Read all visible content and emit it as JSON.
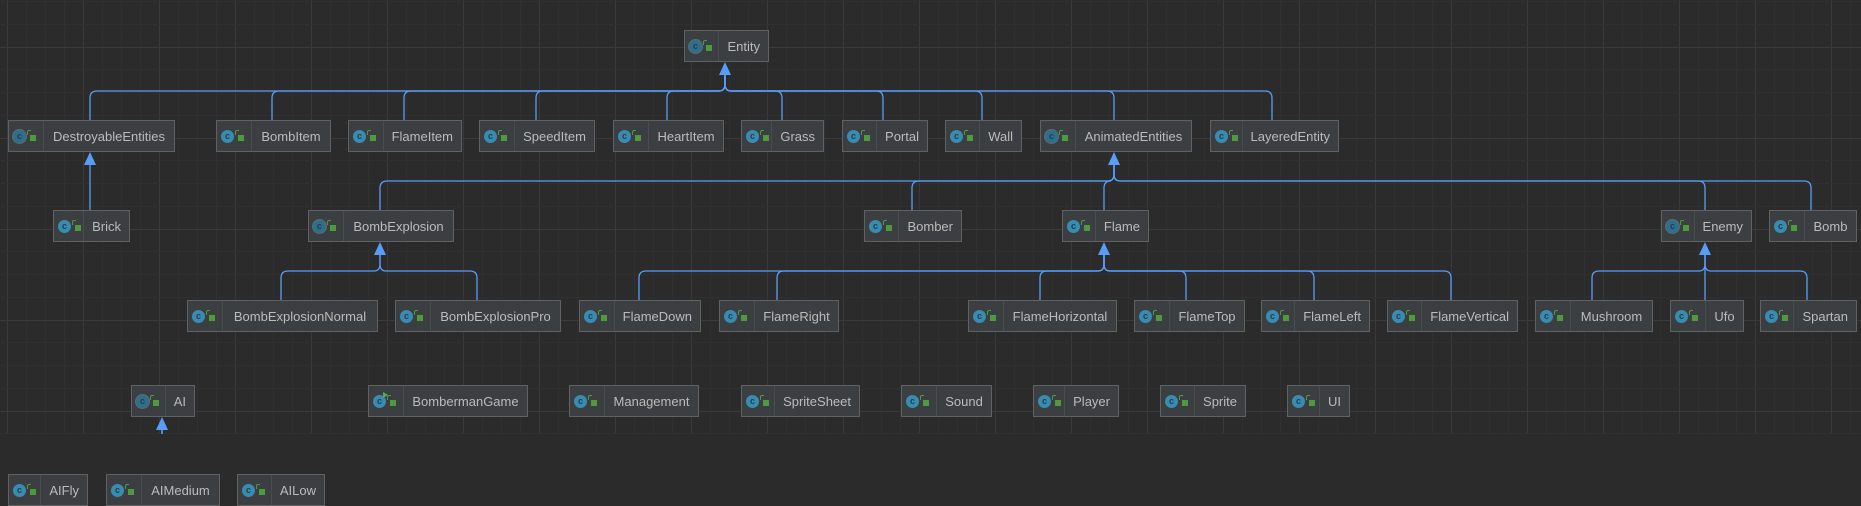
{
  "diagram": {
    "edge_color": "#589df6",
    "nodes": [
      {
        "name": "Entity",
        "kind": "abstract",
        "parent": null
      },
      {
        "name": "DestroyableEntities",
        "kind": "abstract",
        "parent": "Entity"
      },
      {
        "name": "BombItem",
        "kind": "class",
        "parent": "Entity"
      },
      {
        "name": "FlameItem",
        "kind": "class",
        "parent": "Entity"
      },
      {
        "name": "SpeedItem",
        "kind": "class",
        "parent": "Entity"
      },
      {
        "name": "HeartItem",
        "kind": "class",
        "parent": "Entity"
      },
      {
        "name": "Grass",
        "kind": "class",
        "parent": "Entity"
      },
      {
        "name": "Portal",
        "kind": "class",
        "parent": "Entity"
      },
      {
        "name": "Wall",
        "kind": "class",
        "parent": "Entity"
      },
      {
        "name": "AnimatedEntities",
        "kind": "abstract",
        "parent": "Entity"
      },
      {
        "name": "LayeredEntity",
        "kind": "class",
        "parent": "Entity"
      },
      {
        "name": "Brick",
        "kind": "class",
        "parent": "DestroyableEntities"
      },
      {
        "name": "BombExplosion",
        "kind": "abstract",
        "parent": "AnimatedEntities"
      },
      {
        "name": "Bomber",
        "kind": "class",
        "parent": "AnimatedEntities"
      },
      {
        "name": "Flame",
        "kind": "class",
        "parent": "AnimatedEntities"
      },
      {
        "name": "Enemy",
        "kind": "abstract",
        "parent": "AnimatedEntities"
      },
      {
        "name": "Bomb",
        "kind": "class",
        "parent": "AnimatedEntities"
      },
      {
        "name": "BombExplosionNormal",
        "kind": "class",
        "parent": "BombExplosion"
      },
      {
        "name": "BombExplosionPro",
        "kind": "class",
        "parent": "BombExplosion"
      },
      {
        "name": "FlameDown",
        "kind": "class",
        "parent": "Flame"
      },
      {
        "name": "FlameRight",
        "kind": "class",
        "parent": "Flame"
      },
      {
        "name": "FlameHorizontal",
        "kind": "class",
        "parent": "Flame"
      },
      {
        "name": "FlameTop",
        "kind": "class",
        "parent": "Flame"
      },
      {
        "name": "FlameLeft",
        "kind": "class",
        "parent": "Flame"
      },
      {
        "name": "FlameVertical",
        "kind": "class",
        "parent": "Flame"
      },
      {
        "name": "Mushroom",
        "kind": "class",
        "parent": "Enemy"
      },
      {
        "name": "Ufo",
        "kind": "class",
        "parent": "Enemy"
      },
      {
        "name": "Spartan",
        "kind": "class",
        "parent": "Enemy"
      },
      {
        "name": "AI",
        "kind": "abstract",
        "parent": null
      },
      {
        "name": "AIFly",
        "kind": "class",
        "parent": "AI"
      },
      {
        "name": "AIMedium",
        "kind": "class",
        "parent": "AI"
      },
      {
        "name": "AILow",
        "kind": "class",
        "parent": "AI"
      },
      {
        "name": "BombermanGame",
        "kind": "main",
        "parent": null
      },
      {
        "name": "Management",
        "kind": "class",
        "parent": null
      },
      {
        "name": "SpriteSheet",
        "kind": "class",
        "parent": null
      },
      {
        "name": "Sound",
        "kind": "class",
        "parent": null
      },
      {
        "name": "Player",
        "kind": "class",
        "parent": null
      },
      {
        "name": "Sprite",
        "kind": "class",
        "parent": null
      },
      {
        "name": "UI",
        "kind": "class",
        "parent": null
      }
    ]
  }
}
